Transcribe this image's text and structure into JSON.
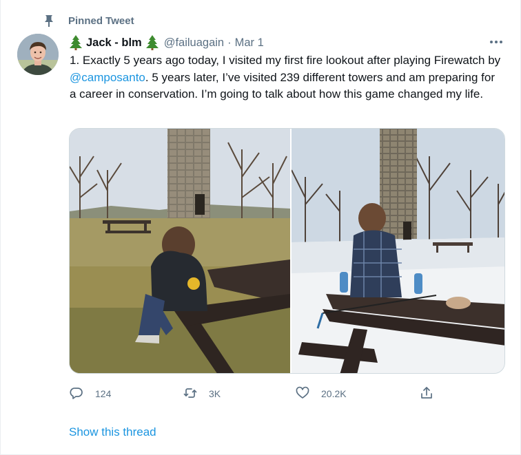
{
  "pinned": {
    "label": "Pinned Tweet",
    "icon": "pin-icon"
  },
  "author": {
    "display_name": "Jack - blm",
    "name_emoji": "evergreen-tree-icon",
    "handle": "@failuagain",
    "separator": "·",
    "date": "Mar 1"
  },
  "tweet": {
    "text_1": "1. Exactly 5 years ago today, I visited my first fire lookout after playing Firewatch by ",
    "mention": "@camposanto",
    "text_2": ". 5 years later, I’ve visited 239 different towers and am preparing for a career in conservation. I’m going to talk about how this game changed my life."
  },
  "actions": {
    "reply": {
      "icon": "reply-icon",
      "count": "124"
    },
    "retweet": {
      "icon": "retweet-icon",
      "count": "3K"
    },
    "like": {
      "icon": "heart-icon",
      "count": "20.2K"
    },
    "share": {
      "icon": "share-icon"
    }
  },
  "show_thread": "Show this thread",
  "colors": {
    "accent": "#1b95e0",
    "secondary_text": "#5b7083",
    "border": "#ebeef0"
  }
}
